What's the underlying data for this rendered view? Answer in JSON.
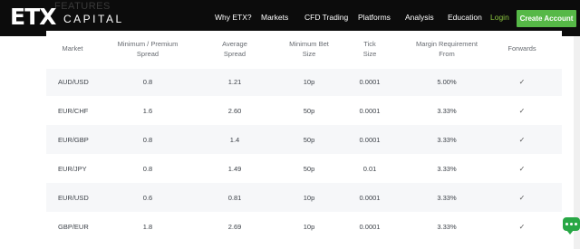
{
  "header": {
    "logo_mark": "ETX",
    "logo_word": "CAPITAL",
    "ghost_text": "FEATURES",
    "nav": [
      "Why ETX?",
      "Markets",
      "CFD Trading",
      "Platforms",
      "Analysis",
      "Education"
    ],
    "login_label": "Login",
    "cta_label": "Create Account",
    "colors": {
      "bg": "#0c0c0c",
      "cta": "#56b847",
      "login": "#8cc63f"
    }
  },
  "table": {
    "headers": [
      [
        "Market",
        ""
      ],
      [
        "Minimum / Premium",
        "Spread"
      ],
      [
        "Average",
        "Spread"
      ],
      [
        "Minimum Bet",
        "Size"
      ],
      [
        "Tick",
        "Size"
      ],
      [
        "Margin Requirement",
        "From"
      ],
      [
        "Forwards",
        ""
      ]
    ],
    "rows": [
      [
        "AUD/USD",
        "0.8",
        "1.21",
        "10p",
        "0.0001",
        "5.00%",
        "✓"
      ],
      [
        "EUR/CHF",
        "1.6",
        "2.60",
        "50p",
        "0.0001",
        "3.33%",
        "✓"
      ],
      [
        "EUR/GBP",
        "0.8",
        "1.4",
        "50p",
        "0.0001",
        "3.33%",
        "✓"
      ],
      [
        "EUR/JPY",
        "0.8",
        "1.49",
        "50p",
        "0.01",
        "3.33%",
        "✓"
      ],
      [
        "EUR/USD",
        "0.6",
        "0.81",
        "10p",
        "0.0001",
        "3.33%",
        "✓"
      ],
      [
        "GBP/EUR",
        "1.8",
        "2.69",
        "10p",
        "0.0001",
        "3.33%",
        "✓"
      ]
    ]
  },
  "icons": {
    "chat": "chat-bubble-icon",
    "check": "checkmark-icon"
  }
}
